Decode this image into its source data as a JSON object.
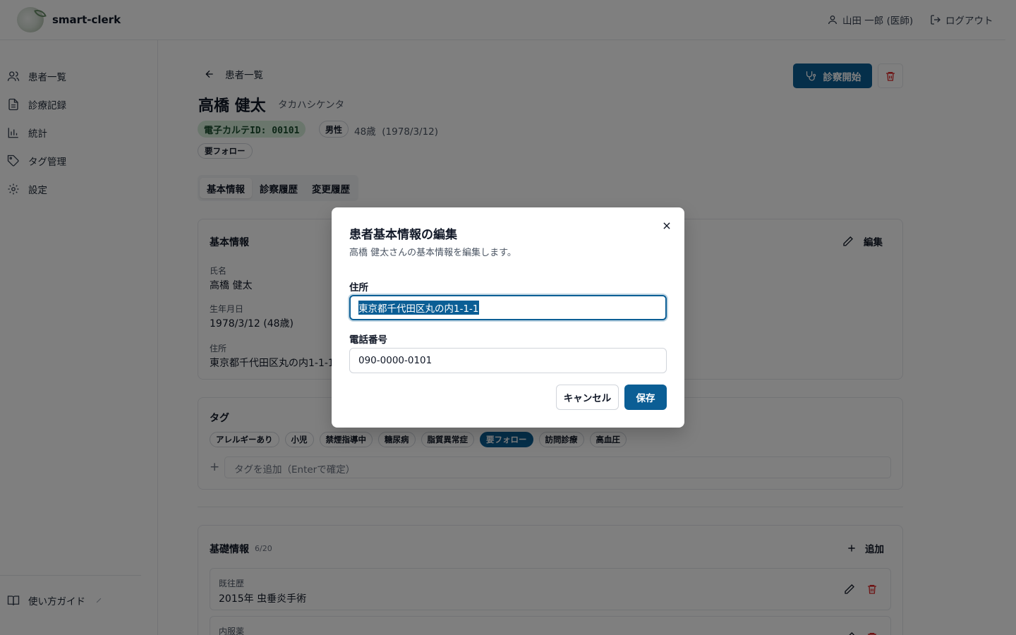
{
  "header": {
    "app_name": "smart-clerk",
    "user": "山田 一郎 (医師)",
    "logout": "ログアウト"
  },
  "sidebar": {
    "items": [
      {
        "label": "患者一覧",
        "icon": "users-icon"
      },
      {
        "label": "診療記録",
        "icon": "file-text-icon"
      },
      {
        "label": "統計",
        "icon": "bar-chart-icon"
      },
      {
        "label": "タグ管理",
        "icon": "tag-icon"
      },
      {
        "label": "設定",
        "icon": "gear-icon"
      }
    ],
    "guide": "使い方ガイド"
  },
  "page": {
    "back_label": "患者一覧",
    "start_button": "診察開始",
    "patient_name": "高橋 健太",
    "patient_kana": "タカハシケンタ",
    "ehr_id": "電子カルテID: 00101",
    "gender": "男性",
    "age": "48歳",
    "birth_paren": "(1978/3/12)",
    "follow_badge": "要フォロー",
    "tabs": [
      "基本情報",
      "診察履歴",
      "変更履歴"
    ],
    "active_tab": "基本情報"
  },
  "basic_info": {
    "title": "基本情報",
    "edit_label": "編集",
    "name_label": "氏名",
    "name_value": "高橋 健太",
    "birth_label": "生年月日",
    "birth_value": "1978/3/12 (48歳)",
    "address_label": "住所",
    "address_value": "東京都千代田区丸の内1-1-1"
  },
  "tags": {
    "title": "タグ",
    "items": [
      "アレルギーあり",
      "小児",
      "禁煙指導中",
      "糖尿病",
      "脂質異常症",
      "要フォロー",
      "訪問診療",
      "高血圧"
    ],
    "selected": "要フォロー",
    "input_placeholder": "タグを追加（Enterで確定）"
  },
  "foundation": {
    "title": "基礎情報",
    "count": "6/20",
    "add_label": "追加",
    "items": [
      {
        "label": "既往歴",
        "value": "2015年 虫垂炎手術"
      },
      {
        "label": "内服薬",
        "value": ""
      }
    ]
  },
  "modal": {
    "title": "患者基本情報の編集",
    "description": "高橋 健太さんの基本情報を編集します。",
    "address_label": "住所",
    "address_value": "東京都千代田区丸の内1-1-1",
    "phone_label": "電話番号",
    "phone_value": "090-0000-0101",
    "cancel": "キャンセル",
    "save": "保存"
  },
  "colors": {
    "primary": "#0b5e95",
    "danger": "#dc2626",
    "ehr_badge_bg": "#d4ecd9"
  }
}
